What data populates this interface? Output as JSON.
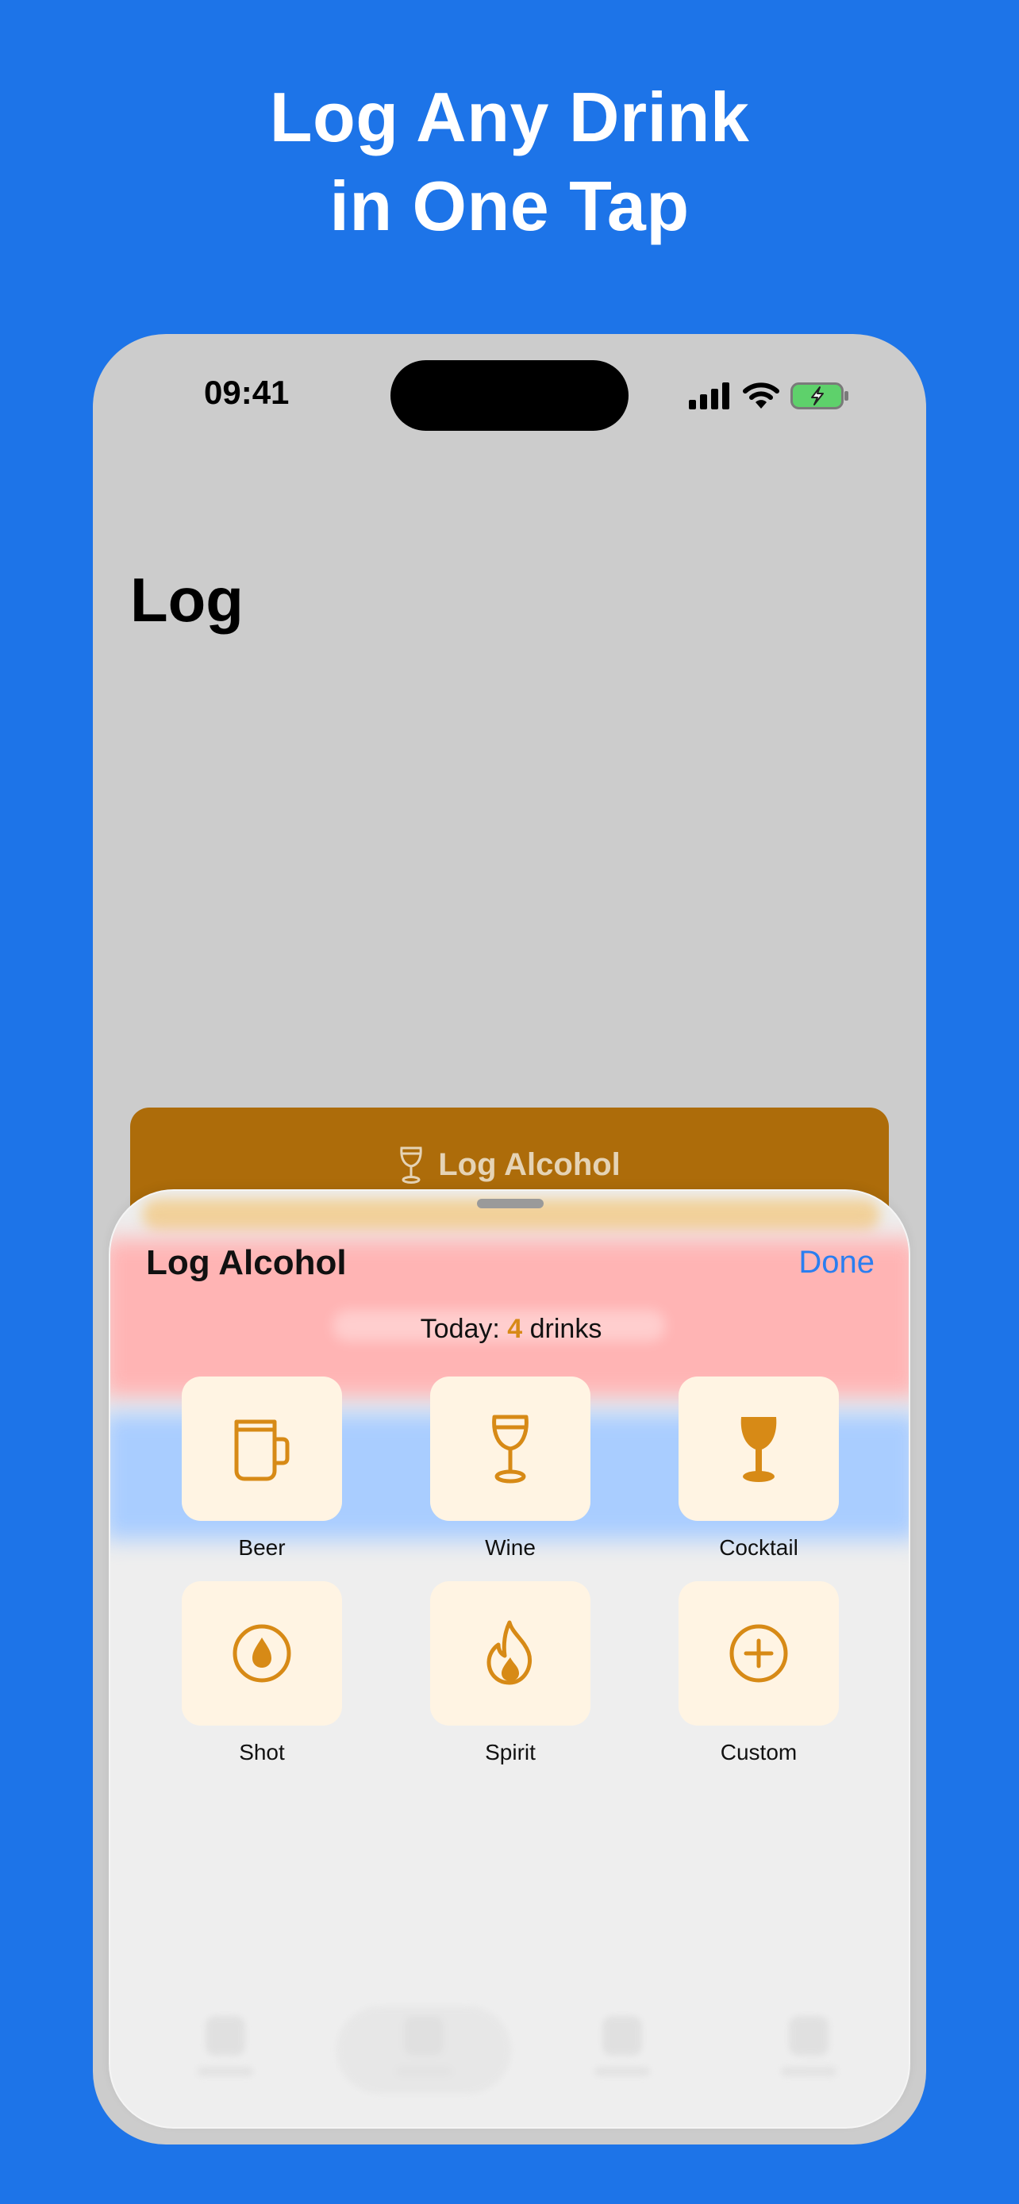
{
  "headline": {
    "line1": "Log Any Drink",
    "line2": "in One Tap"
  },
  "status_bar": {
    "time": "09:41",
    "icons": [
      "cellular-signal-icon",
      "wifi-icon",
      "battery-charging-icon"
    ]
  },
  "page": {
    "title": "Log"
  },
  "log_button": {
    "label": "Log Alcohol",
    "icon": "wine-glass-icon"
  },
  "sheet": {
    "title": "Log Alcohol",
    "done_label": "Done",
    "today_prefix": "Today: ",
    "today_count": "4",
    "today_suffix": " drinks",
    "drinks": [
      {
        "label": "Beer",
        "icon": "beer-mug-icon"
      },
      {
        "label": "Wine",
        "icon": "wine-glass-icon"
      },
      {
        "label": "Cocktail",
        "icon": "cocktail-glass-icon"
      },
      {
        "label": "Shot",
        "icon": "drop-icon"
      },
      {
        "label": "Spirit",
        "icon": "flame-icon"
      },
      {
        "label": "Custom",
        "icon": "plus-circle-icon"
      }
    ]
  },
  "colors": {
    "background": "#1d74e8",
    "phone_screen": "#cccccc",
    "button_brown": "#ad6c0a",
    "accent_orange": "#d78a16",
    "tile_bg": "#fff4e3",
    "done_blue": "#2a7ef0",
    "battery_green": "#5ed16b"
  }
}
